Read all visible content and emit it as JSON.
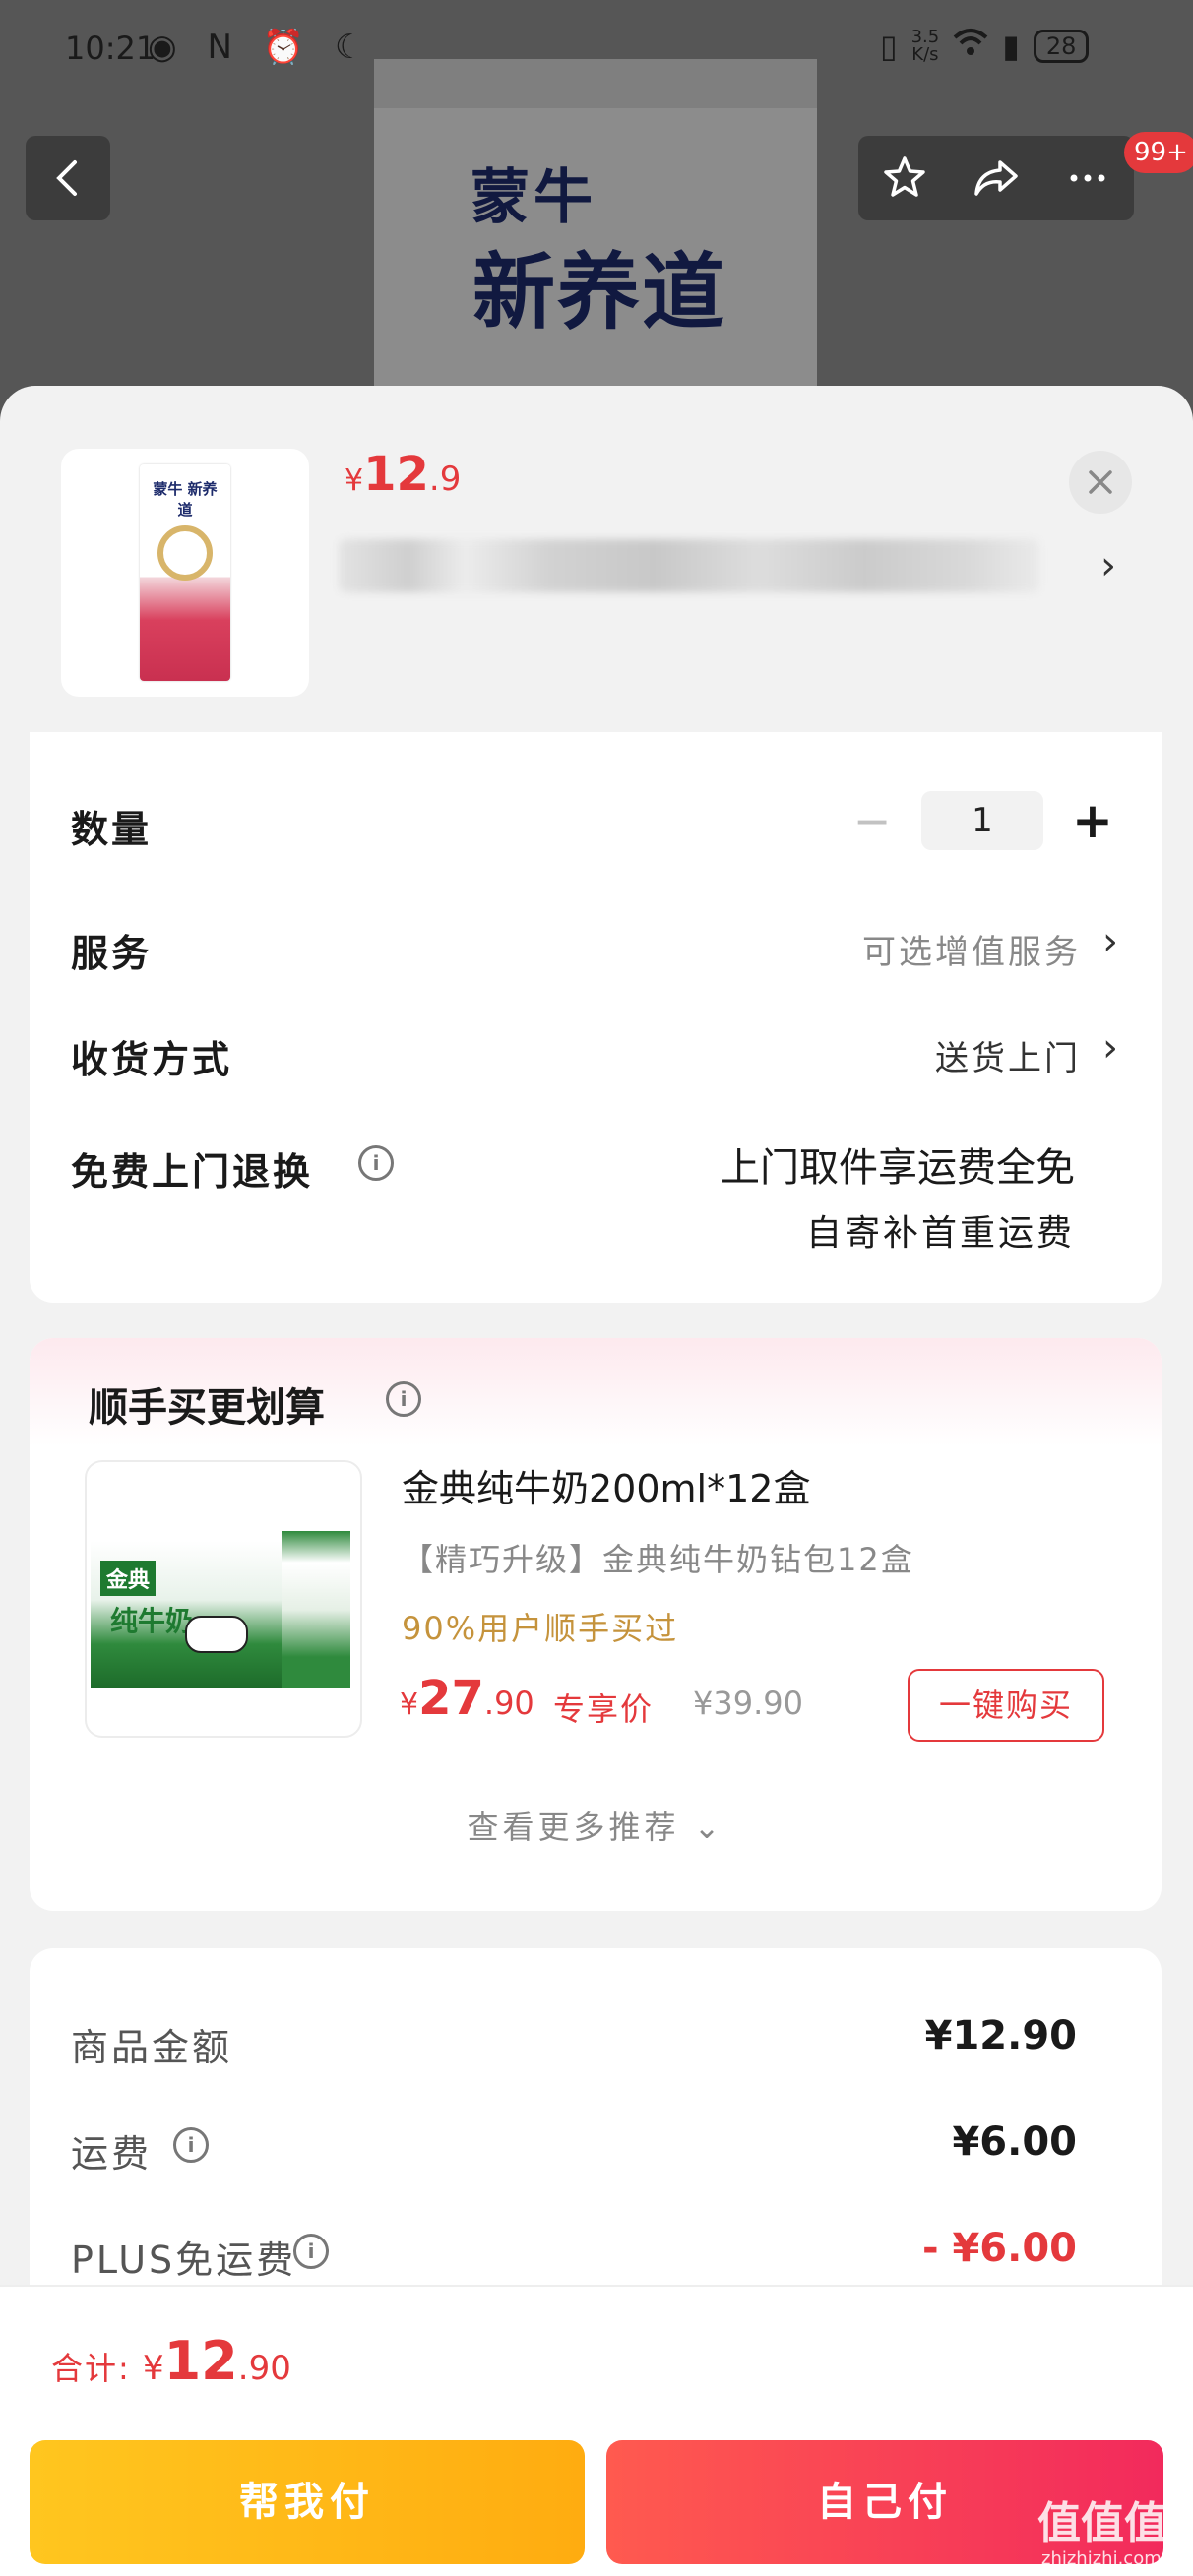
{
  "status_bar": {
    "time": "10:21",
    "left_icons": "◉ N ⏰ ☾",
    "net_speed_value": "3.5",
    "net_speed_unit": "K/s",
    "battery": "28"
  },
  "hero": {
    "brand_logo": "蒙牛",
    "brand_name": "新养道"
  },
  "nav": {
    "badge": "99+"
  },
  "product": {
    "pack_logo": "蒙牛 新养道",
    "price_symbol": "¥",
    "price_int": "12",
    "price_dec": ".9"
  },
  "options": {
    "quantity_label": "数量",
    "quantity_minus": "−",
    "quantity_value": "1",
    "quantity_plus": "+",
    "service_label": "服务",
    "service_value": "可选增值服务",
    "delivery_label": "收货方式",
    "delivery_value": "送货上门",
    "return_label": "免费上门退换",
    "return_line1": "上门取件享运费全免",
    "return_line2": "自寄补首重运费",
    "chevron": "›",
    "info_glyph": "i"
  },
  "recommend": {
    "title": "顺手买更划算",
    "product_name": "金典纯牛奶200ml*12盒",
    "product_desc": "【精巧升级】金典纯牛奶钻包12盒",
    "social_proof": "90%用户顺手买过",
    "price_symbol": "¥",
    "price_int": "27",
    "price_dec": ".90",
    "price_tag": "专享价",
    "original_price": "¥39.90",
    "buy_button": "一键购买",
    "more_link": "查看更多推荐 ⌄",
    "img_brand": "金典",
    "img_brand_text": "纯牛奶"
  },
  "summary": {
    "rows": [
      {
        "label": "商品金额",
        "value": "¥12.90"
      },
      {
        "label": "运费",
        "value": "¥6.00"
      },
      {
        "label": "PLUS免运费",
        "value": "- ¥6.00"
      }
    ]
  },
  "footer": {
    "total_label": "合计: ",
    "total_symbol": "¥",
    "total_int": "12",
    "total_dec": ".90",
    "help_pay_button": "帮我付",
    "self_pay_button": "自己付"
  },
  "watermark": {
    "text": "值值值",
    "sub": "zhizhizhi.com"
  },
  "colors": {
    "accent_red": "#e4393c",
    "help_pay_yellow": "#ffb814",
    "self_pay_red": "#f5344f",
    "social_proof_gold": "#c5933c"
  },
  "icons": [
    "back-arrow-icon",
    "star-icon",
    "share-icon",
    "more-icon",
    "close-icon",
    "info-icon",
    "chevron-right-icon",
    "chevron-down-icon"
  ]
}
